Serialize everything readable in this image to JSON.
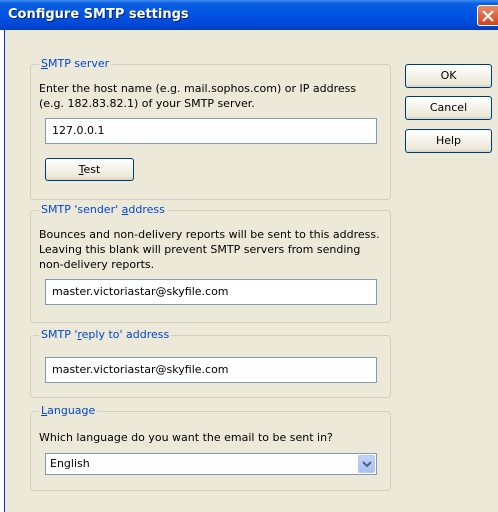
{
  "window": {
    "title": "Configure SMTP settings"
  },
  "buttons": {
    "ok": "OK",
    "cancel": "Cancel",
    "help": "Help"
  },
  "smtp_server": {
    "legend_accel": "S",
    "legend_rest": "MTP server",
    "description": "Enter the host name (e.g. mail.sophos.com) or IP address (e.g. 182.83.82.1) of your SMTP server.",
    "value": "127.0.0.1",
    "test_accel": "T",
    "test_rest": "est"
  },
  "sender": {
    "legend_before": "SMTP 'sender' ",
    "legend_accel": "a",
    "legend_after": "ddress",
    "description": "Bounces and non-delivery reports will be sent to this address. Leaving this blank will prevent SMTP servers from sending non-delivery reports.",
    "value": "master.victoriastar@skyfile.com"
  },
  "reply_to": {
    "legend_before": "SMTP '",
    "legend_accel": "r",
    "legend_after": "eply to' address",
    "value": "master.victoriastar@skyfile.com"
  },
  "language": {
    "legend_accel": "L",
    "legend_rest": "anguage",
    "question": "Which language do you want the email to be sent in?",
    "selected": "English"
  }
}
